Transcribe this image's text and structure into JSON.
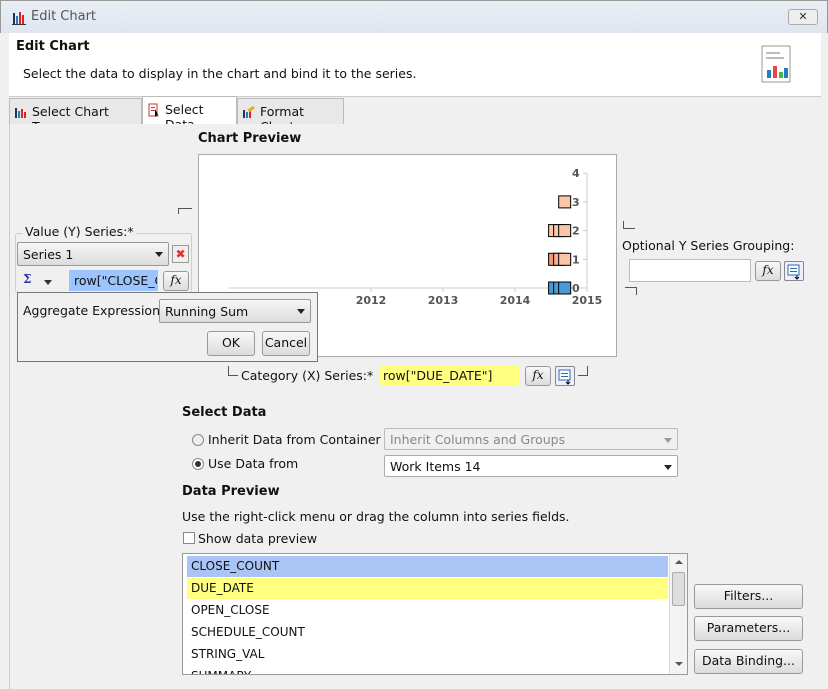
{
  "window": {
    "title": "Edit Chart",
    "close_label": "✕"
  },
  "header": {
    "title": "Edit Chart",
    "subtitle": "Select the data to display in the chart and bind it to the series."
  },
  "tabs": [
    {
      "label": "Select Chart Type"
    },
    {
      "label": "Select Data",
      "active": true
    },
    {
      "label": "Format Chart"
    }
  ],
  "preview": {
    "title": "Chart Preview",
    "chart": {
      "x_ticks": [
        "2012",
        "2013",
        "2014",
        "2015"
      ],
      "y_ticks": [
        "4",
        "3",
        "2",
        "1",
        "0"
      ],
      "markers": [
        {
          "x": 2014.55,
          "y": 0,
          "color": "#4a9ad4"
        },
        {
          "x": 2014.62,
          "y": 0,
          "color": "#4a9ad4"
        },
        {
          "x": 2014.69,
          "y": 0,
          "color": "#4a9ad4"
        },
        {
          "x": 2014.55,
          "y": 1,
          "color": "#f59a70"
        },
        {
          "x": 2014.62,
          "y": 1,
          "color": "#f8b090"
        },
        {
          "x": 2014.69,
          "y": 1,
          "color": "#fbc5a8"
        },
        {
          "x": 2014.55,
          "y": 2,
          "color": "#fbc5a8"
        },
        {
          "x": 2014.62,
          "y": 2,
          "color": "#fbc5a8"
        },
        {
          "x": 2014.69,
          "y": 2,
          "color": "#fbc5a8"
        },
        {
          "x": 2014.69,
          "y": 3,
          "color": "#fbc5a8"
        }
      ]
    }
  },
  "value_series": {
    "label": "Value (Y) Series:*",
    "series_select": "Series 1",
    "expression": "row[\"CLOSE_C",
    "aggregate_icon": "Σ"
  },
  "aggregate_popup": {
    "label": "Aggregate Expression:",
    "value": "Running Sum",
    "ok": "OK",
    "cancel": "Cancel"
  },
  "optional_grouping": {
    "label": "Optional Y Series Grouping:",
    "value": ""
  },
  "category_series": {
    "label": "Category (X) Series:*",
    "expression": "row[\"DUE_DATE\"]"
  },
  "fx_label": "fx",
  "select_data": {
    "title": "Select Data",
    "inherit": {
      "label": "Inherit Data from Container",
      "value": "Inherit Columns and Groups",
      "selected": false
    },
    "use": {
      "label": "Use Data from",
      "value": "Work Items 14",
      "selected": true
    }
  },
  "data_preview": {
    "title": "Data Preview",
    "hint": "Use the right-click menu or drag the column into series fields.",
    "show_label": "Show data preview",
    "show_checked": false,
    "columns": [
      "CLOSE_COUNT",
      "DUE_DATE",
      "OPEN_CLOSE",
      "SCHEDULE_COUNT",
      "STRING_VAL",
      "SUMMARY"
    ]
  },
  "buttons": {
    "filters": "Filters...",
    "parameters": "Parameters...",
    "data_binding": "Data Binding..."
  }
}
